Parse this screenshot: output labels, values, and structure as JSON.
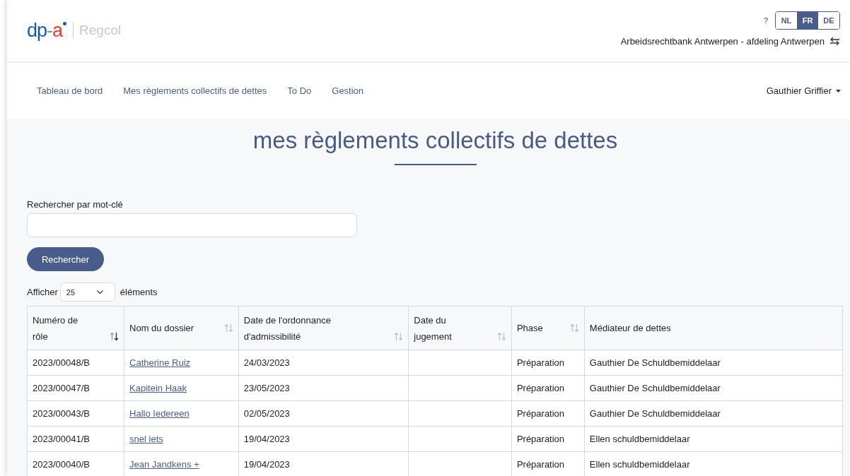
{
  "header": {
    "logo": [
      {
        "text": "dp",
        "color": "#1d5aa6"
      },
      {
        "text": "-",
        "color": "#8a8a8a"
      },
      {
        "text": "a",
        "color": "#e5402b"
      }
    ],
    "product": "Regcol",
    "help": "?",
    "languages": [
      {
        "label": "NL",
        "selected": false
      },
      {
        "label": "FR",
        "selected": true
      },
      {
        "label": "DE",
        "selected": false
      }
    ],
    "court": "Arbeidsrechtbank Antwerpen - afdeling Antwerpen"
  },
  "nav": {
    "items": [
      "Tableau de bord",
      "Mes règlements collectifs de dettes",
      "To Do",
      "Gestion"
    ],
    "user": "Gauthier Griffier"
  },
  "page": {
    "title": "mes règlements collectifs de dettes",
    "search_label": "Rechercher par mot-clé",
    "search_button": "Rechercher",
    "show_label": "Afficher",
    "page_size": "25",
    "items_label": "éléments"
  },
  "table": {
    "columns": [
      {
        "label": "Numéro de rôle",
        "sorted": true
      },
      {
        "label": "Nom du dossier",
        "sorted": false
      },
      {
        "label": "Date de l'ordonnance d'admissibilité",
        "sorted": false
      },
      {
        "label": "Date du jugement",
        "sorted": false
      },
      {
        "label": "Phase",
        "sorted": false
      },
      {
        "label": "Médiateur de dettes"
      }
    ],
    "rows": [
      [
        "2023/00048/B",
        "Catherine Ruiz",
        "24/03/2023",
        "",
        "Préparation",
        "Gauthier De Schuldbemiddelaar"
      ],
      [
        "2023/00047/B",
        "Kapitein Haak",
        "23/05/2023",
        "",
        "Préparation",
        "Gauthier De Schuldbemiddelaar"
      ],
      [
        "2023/00043/B",
        "Hallo Iedereen",
        "02/05/2023",
        "",
        "Préparation",
        "Gauthier De Schuldbemiddelaar"
      ],
      [
        "2023/00041/B",
        "snel iets",
        "19/04/2023",
        "",
        "Préparation",
        "Ellen schuldbemiddelaar"
      ],
      [
        "2023/00040/B",
        "Jean Jandkens +",
        "19/04/2023",
        "",
        "Préparation",
        "Ellen schuldbemiddelaar"
      ]
    ]
  }
}
